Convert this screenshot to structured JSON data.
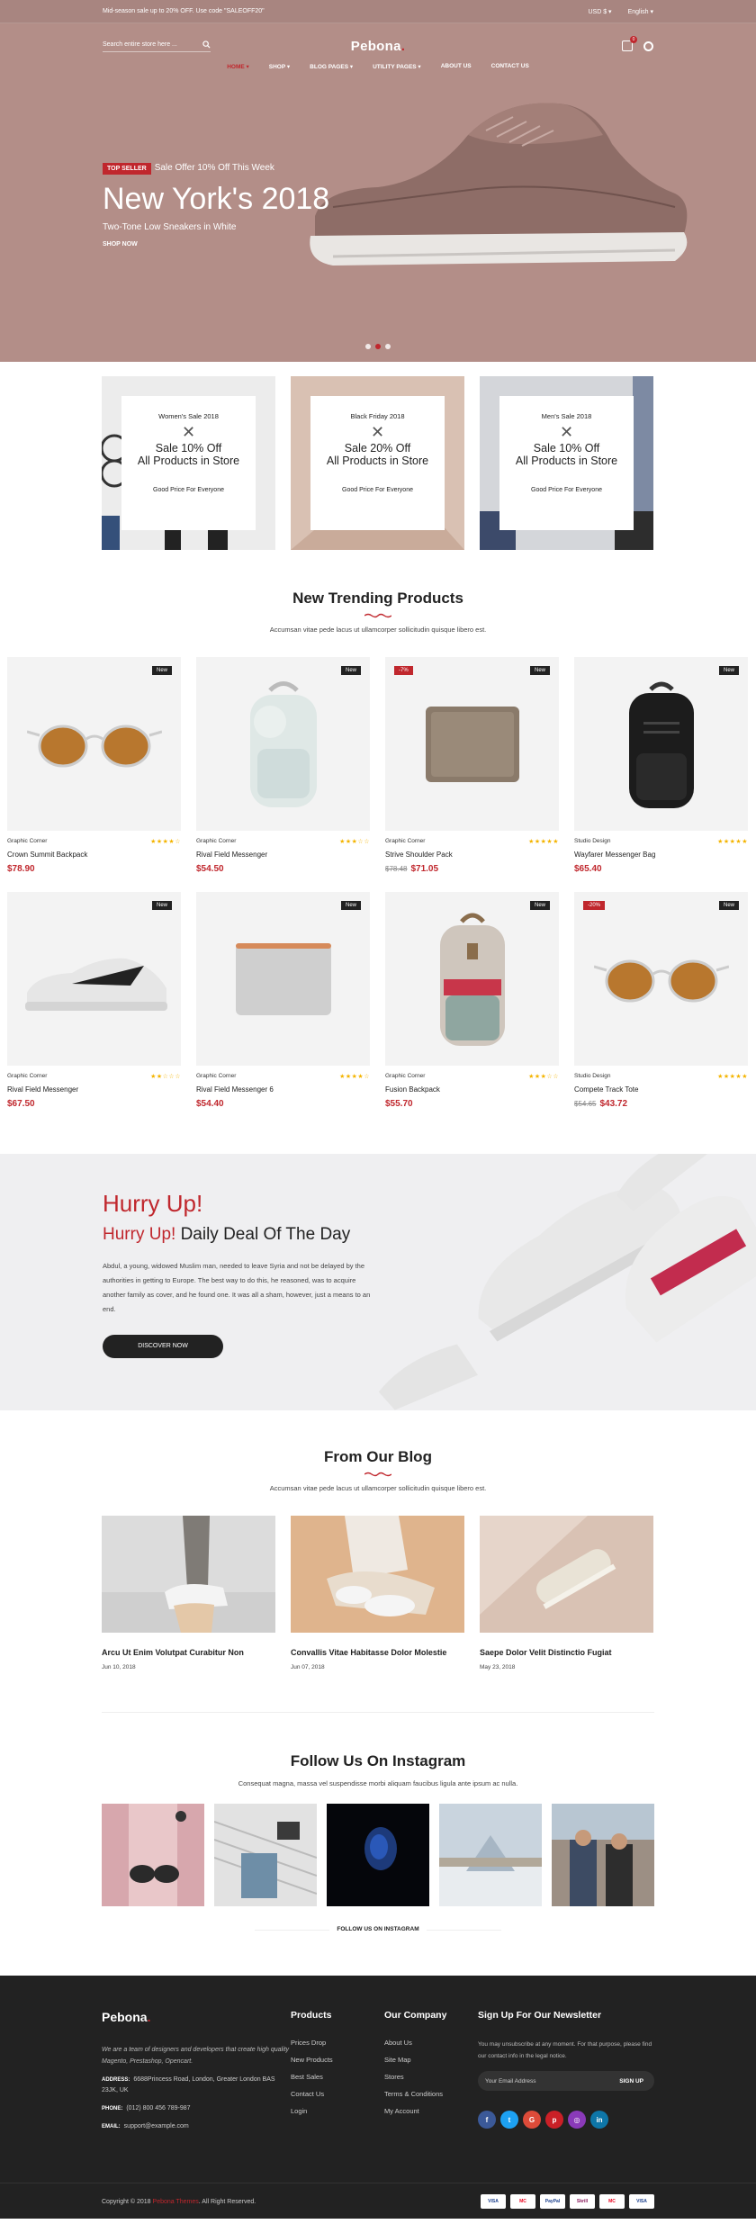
{
  "topbar": {
    "promo": "Mid-season sale up to 20% OFF. Use code \"SALEOFF20\"",
    "currency": "USD $",
    "language": "English"
  },
  "header": {
    "search_placeholder": "Search entire store here ...",
    "logo": "Pebona",
    "cart_count": "0"
  },
  "nav": [
    "HOME",
    "SHOP",
    "BLOG PAGES",
    "UTILITY PAGES",
    "ABOUT US",
    "CONTACT US"
  ],
  "hero": {
    "badge": "TOP SELLER",
    "offer": "Sale Offer 10% Off This Week",
    "title": "New York's 2018",
    "subtitle": "Two-Tone Low Sneakers in White",
    "cta": "SHOP NOW"
  },
  "banners": [
    {
      "kicker": "Women's Sale 2018",
      "line1": "Sale 10% Off",
      "line2": "All Products in Store",
      "foot": "Good Price For Everyone"
    },
    {
      "kicker": "Black Friday 2018",
      "line1": "Sale 20% Off",
      "line2": "All Products in Store",
      "foot": "Good Price For Everyone"
    },
    {
      "kicker": "Men's Sale 2018",
      "line1": "Sale 10% Off",
      "line2": "All Products in Store",
      "foot": "Good Price For Everyone"
    }
  ],
  "trending": {
    "title": "New Trending Products",
    "desc": "Accumsan vitae pede lacus ut ullamcorper sollicitudin quisque libero est."
  },
  "products": [
    {
      "brand": "Graphic Corner",
      "name": "Crown Summit Backpack",
      "price": "$78.90",
      "old": "",
      "tag": "New",
      "sale": "",
      "stars": "★★★★☆"
    },
    {
      "brand": "Graphic Corner",
      "name": "Rival Field Messenger",
      "price": "$54.50",
      "old": "",
      "tag": "New",
      "sale": "",
      "stars": "★★★☆☆"
    },
    {
      "brand": "Graphic Corner",
      "name": "Strive Shoulder Pack",
      "price": "$71.05",
      "old": "$78.48",
      "tag": "New",
      "sale": "-7%",
      "stars": "★★★★★"
    },
    {
      "brand": "Studio Design",
      "name": "Wayfarer Messenger Bag",
      "price": "$65.40",
      "old": "",
      "tag": "New",
      "sale": "",
      "stars": "★★★★★"
    },
    {
      "brand": "Graphic Corner",
      "name": "Rival Field Messenger",
      "price": "$67.50",
      "old": "",
      "tag": "New",
      "sale": "",
      "stars": "★★☆☆☆"
    },
    {
      "brand": "Graphic Corner",
      "name": "Rival Field Messenger 6",
      "price": "$54.40",
      "old": "",
      "tag": "New",
      "sale": "",
      "stars": "★★★★☆"
    },
    {
      "brand": "Graphic Corner",
      "name": "Fusion Backpack",
      "price": "$55.70",
      "old": "",
      "tag": "New",
      "sale": "",
      "stars": "★★★☆☆"
    },
    {
      "brand": "Studio Design",
      "name": "Compete Track Tote",
      "price": "$43.72",
      "old": "$54.65",
      "tag": "New",
      "sale": "-20%",
      "stars": "★★★★★"
    }
  ],
  "deal": {
    "title": "Hurry Up!",
    "sub_red": "Hurry Up!",
    "sub": "Daily Deal Of The Day",
    "text": "Abdul, a young, widowed Muslim man, needed to leave Syria and not be delayed by the authorities in getting to Europe. The best way to do this, he reasoned, was to acquire another family as cover, and he found one. It was all a sham, however, just a means to an end.",
    "cta": "DISCOVER NOW"
  },
  "blog": {
    "title": "From Our Blog",
    "desc": "Accumsan vitae pede lacus ut ullamcorper sollicitudin quisque libero est.",
    "posts": [
      {
        "title": "Arcu Ut Enim Volutpat Curabitur Non",
        "date": "Jun 10, 2018"
      },
      {
        "title": "Convallis Vitae Habitasse Dolor Molestie",
        "date": "Jun 07, 2018"
      },
      {
        "title": "Saepe Dolor Velit Distinctio Fugiat",
        "date": "May 23, 2018"
      }
    ]
  },
  "instagram": {
    "title": "Follow Us On Instagram",
    "desc": "Consequat magna, massa vel suspendisse morbi aliquam faucibus ligula ante ipsum ac nulla.",
    "follow": "FOLLOW US ON INSTAGRAM"
  },
  "footer": {
    "logo": "Pebona",
    "about": "We are a team of designers and developers that create high quality Magento, Prestashop, Opencart.",
    "address_label": "ADDRESS:",
    "address": "6688Princess Road, London, Greater London BAS 23JK, UK",
    "phone_label": "PHONE:",
    "phone": "(012) 800 456 789-987",
    "email_label": "EMAIL:",
    "email": "support@example.com",
    "products_title": "Products",
    "products": [
      "Prices Drop",
      "New Products",
      "Best Sales",
      "Contact Us",
      "Login"
    ],
    "company_title": "Our Company",
    "company": [
      "About Us",
      "Site Map",
      "Stores",
      "Terms & Conditions",
      "My Account"
    ],
    "news_title": "Sign Up For Our Newsletter",
    "news_text": "You may unsubscribe at any moment. For that purpose, please find our contact info in the legal notice.",
    "news_placeholder": "Your Email Address",
    "news_btn": "SIGN UP",
    "copy_pre": "Copyright © 2018",
    "copy_brand": "Pebona Themes",
    "copy_post": ". All Right Reserved.",
    "payments": [
      "VISA",
      "MC",
      "PayPal",
      "Skrill",
      "MC",
      "VISA"
    ]
  }
}
